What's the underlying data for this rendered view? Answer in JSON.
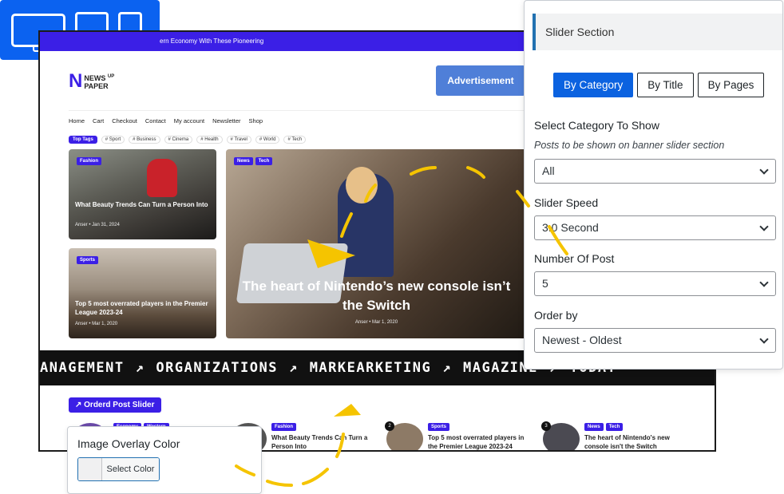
{
  "device_switcher": {
    "devices": [
      "desktop-icon",
      "tablet-icon",
      "mobile-icon"
    ]
  },
  "preview": {
    "ticker_text": "ern Economy With These Pioneering",
    "brand": {
      "mark": "N",
      "line1": "NEWS",
      "line1_sup": "UP",
      "line2": "PAPER"
    },
    "ad_label": "Advertisement",
    "nav": [
      "Home",
      "Cart",
      "Checkout",
      "Contact",
      "My account",
      "Newsletter",
      "Shop"
    ],
    "top_tags_label": "Top Tags",
    "tags": [
      "# Sport",
      "# Business",
      "# Cinema",
      "# Health",
      "# Travel",
      "# World",
      "# Tech"
    ],
    "cards": [
      {
        "category": "Fashion",
        "title": "What Beauty Trends Can Turn a Person Into",
        "author": "Anser",
        "date": "Jan 31, 2024"
      },
      {
        "category": "Sports",
        "title": "Top 5 most overrated players in the Premier League 2023-24",
        "author": "Anser",
        "date": "Mar 1, 2020"
      },
      {
        "categories": [
          "News",
          "Tech"
        ],
        "title": "The heart of Nintendo’s new console isn’t the Switch",
        "author": "Anser",
        "date": "Mar 1, 2020"
      }
    ],
    "marquee": [
      "ANAGEMENT",
      "ORGANIZATIONS",
      "MARKEARKETING",
      "MAGAZINE",
      "TODAY"
    ],
    "marquee_arrow": "↗",
    "ordered_label": "↗ Orderd Post Slider",
    "ordered_posts": [
      {
        "num": "",
        "badges": [
          "Economy",
          "Western"
        ],
        "title": ""
      },
      {
        "num": "",
        "badges": [
          "Fashion"
        ],
        "title": "What Beauty Trends Can Turn a Person Into"
      },
      {
        "num": "2",
        "badges": [
          "Sports"
        ],
        "title": "Top 5 most overrated players in the Premier League 2023-24"
      },
      {
        "num": "3",
        "badges": [
          "News",
          "Tech"
        ],
        "title": "The heart of Nintendo's new console isn't the Switch"
      }
    ]
  },
  "slider_panel": {
    "title": "Slider Section",
    "modes": [
      "By Category",
      "By Title",
      "By Pages"
    ],
    "active_mode": "By Category",
    "category": {
      "label": "Select Category To Show",
      "description": "Posts to be shown on banner slider section",
      "value": "All"
    },
    "speed": {
      "label": "Slider Speed",
      "value": "3.0 Second"
    },
    "count": {
      "label": "Number Of Post",
      "value": "5"
    },
    "order": {
      "label": "Order by",
      "value": "Newest - Oldest"
    }
  },
  "overlay_color": {
    "label": "Image Overlay Color",
    "button_label": "Select Color",
    "swatch_color": "#f0f0f1"
  },
  "colors": {
    "accent": "#0b62e0",
    "brand_purple": "#3b1fe6",
    "doodle_yellow": "#f5c400"
  }
}
